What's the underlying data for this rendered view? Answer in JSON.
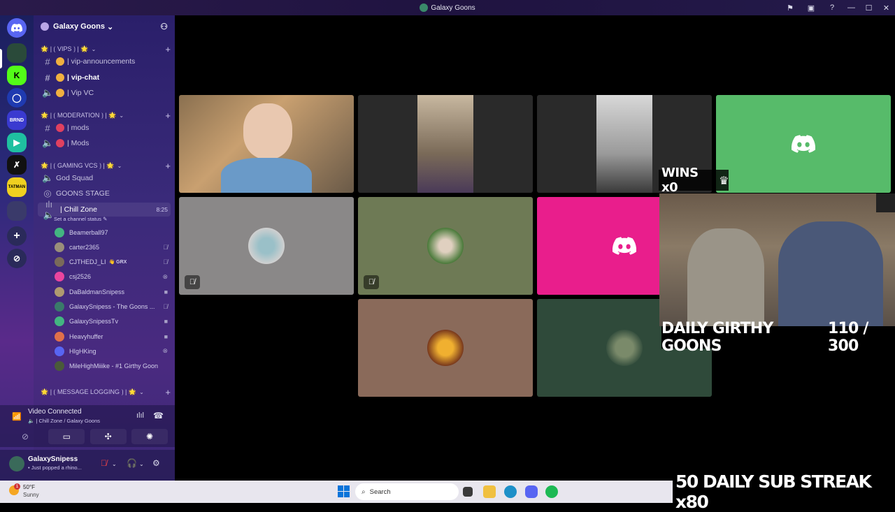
{
  "window": {
    "title": "Galaxy Goons"
  },
  "guild": {
    "name": "Galaxy Goons"
  },
  "categories": [
    {
      "label": "🌟 | ⟮ VIPS ⟯ | 🌟"
    },
    {
      "label": "🌟 | ⟮ MODERATION ⟯ | 🌟"
    },
    {
      "label": "🌟 | ⟮ GAMING VCS ⟯ | 🌟"
    },
    {
      "label": "🌟 | ⟮ MESSAGE LOGGING ⟯ | 🌟"
    }
  ],
  "channels": [
    {
      "name": "| vip-announcements",
      "type": "text"
    },
    {
      "name": "| vip-chat",
      "type": "text"
    },
    {
      "name": "| Vip VC",
      "type": "voice"
    },
    {
      "name": "| mods",
      "type": "text"
    },
    {
      "name": "| Mods",
      "type": "voice"
    },
    {
      "name": "God Squad",
      "type": "voice"
    },
    {
      "name": "GOONS STAGE",
      "type": "stage"
    },
    {
      "name": "| Chill Zone",
      "type": "voice",
      "time": "8:25"
    }
  ],
  "channel_status_prompt": "Set a channel status",
  "voice_members": [
    {
      "name": "Beamerball97",
      "color": "#43b581",
      "icon": ""
    },
    {
      "name": "carter2365",
      "color": "#9a8f7a",
      "icon": "muted-icon"
    },
    {
      "name": "CJTHEDJ_LI",
      "tag": "👋 GRX",
      "color": "#7a6a5a",
      "icon": "muted-icon"
    },
    {
      "name": "csj2526",
      "color": "#eb459e",
      "icon": "xbox-icon"
    },
    {
      "name": "DaBaldmanSnipess",
      "color": "#b09a70",
      "icon": "camera-icon"
    },
    {
      "name": "GalaxySnipess - The Goons ...",
      "color": "#3a7a6a",
      "icon": "muted-icon"
    },
    {
      "name": "GalaxySnipessTv",
      "color": "#43b581",
      "icon": "camera-icon"
    },
    {
      "name": "Heavyhuffer",
      "color": "#e0704a",
      "icon": "camera-icon"
    },
    {
      "name": "HIgHKing",
      "color": "#5865f2",
      "icon": "xbox-icon"
    },
    {
      "name": "MileHighMiiike - #1 Girthy Goon",
      "color": "#4a5a3a",
      "icon": ""
    }
  ],
  "voice_panel": {
    "status": "Video Connected",
    "location": "| Chill Zone / Galaxy Goons"
  },
  "user": {
    "name": "GalaxySnipess",
    "status": "• Just popped a rhino..."
  },
  "overlay": {
    "wins": "WINS x0",
    "girthy_label": "DAILY GIRTHY GOONS",
    "girthy_count": "110 / 300",
    "streak": "50 DAILY SUB STREAK x80"
  },
  "taskbar": {
    "temp": "50°F",
    "condition": "Sunny",
    "search_placeholder": "Search",
    "badge": "1"
  },
  "colors": {
    "discord_green": "#57bb6a",
    "discord_pink": "#e91e8c",
    "tile_gray": "#8a8888",
    "tile_olive": "#6e7a55",
    "tile_brown": "#8a6a5a",
    "tile_darkgreen": "#2f4a3a"
  }
}
